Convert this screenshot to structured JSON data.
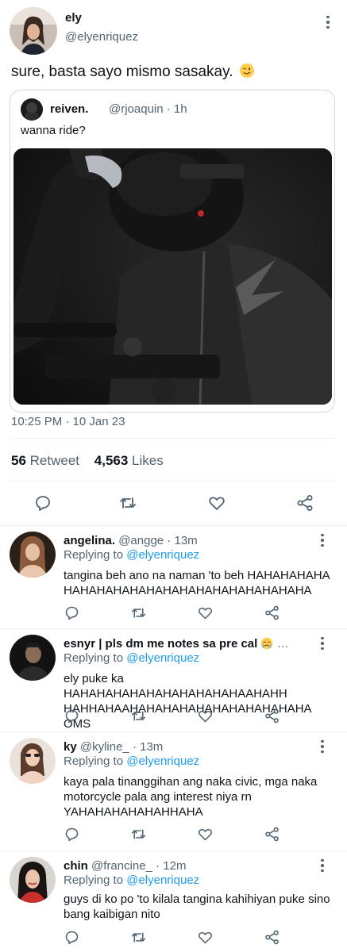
{
  "main": {
    "name": "ely",
    "handle": "@elyenriquez",
    "text": "sure, basta sayo mismo sasakay.",
    "emoji": "wink-emoji",
    "timestamp": "10:25 PM · 10 Jan 23",
    "retweets_count": "56",
    "retweets_label": "Retweet",
    "likes_count": "4,563",
    "likes_label": "Likes"
  },
  "quote": {
    "name": "reiven.",
    "handle": "@rjoaquin · 1h",
    "text": "wanna ride?",
    "photo": "person-in-motorcycle-helmet-and-jacket-photo"
  },
  "replies": [
    {
      "name": "angelina.",
      "handle": "@angge · 13m",
      "replying_prefix": "Replying to",
      "replying_to": "@elyenriquez",
      "text": "tangina beh ano na naman 'to beh HAHAHAHAHA HAHAHAHAHAHAHAHAHAHAHAHAHAHAHA"
    },
    {
      "name": "esnyr | pls dm me notes sa pre cal",
      "handle": "…",
      "replying_prefix": "Replying to",
      "replying_to": "@elyenriquez",
      "text": "ely puke ka HAHAHAHAHAHAHAHAHAHAHAAHAHH HAHHAHAAHAHAHAHAHAHAHAHAHAHAHA OMS"
    },
    {
      "name": "ky",
      "handle": "@kyline_ · 13m",
      "replying_prefix": "Replying to",
      "replying_to": "@elyenriquez",
      "text": "kaya pala tinanggihan ang naka civic, mga naka motorcycle pala ang interest niya rn YAHAHAHAHAHAHHAHA"
    },
    {
      "name": "chin",
      "handle": "@francine_ · 12m",
      "replying_prefix": "Replying to",
      "replying_to": "@elyenriquez",
      "text": "guys di ko po 'to kilala tangina kahihiyan puke sino bang kaibigan nito"
    }
  ],
  "icons": [
    "reply-icon",
    "retweet-icon",
    "like-icon",
    "share-icon",
    "more-icon"
  ],
  "colors": {
    "link": "#1d9bf0",
    "muted": "#536471",
    "text": "#0f1419",
    "divider": "#eff3f4"
  }
}
